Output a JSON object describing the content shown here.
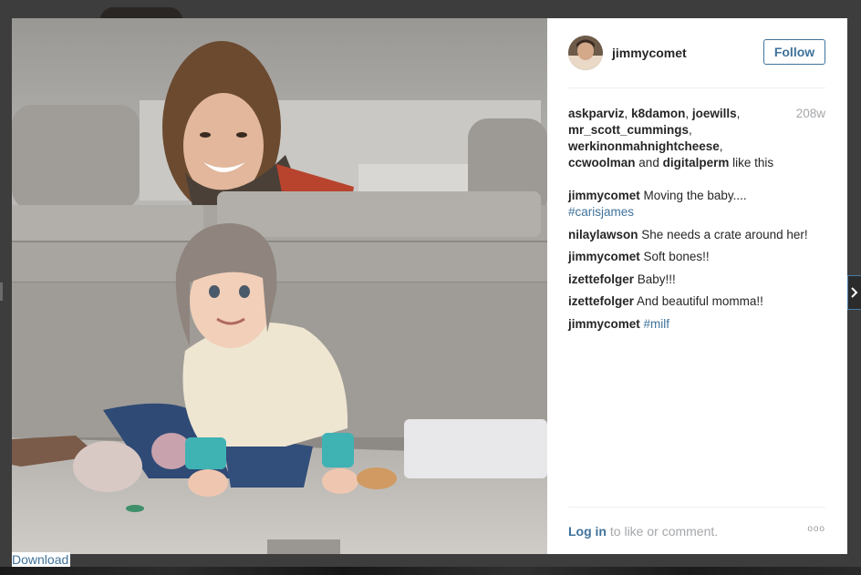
{
  "post": {
    "username": "jimmycomet",
    "follow_label": "Follow",
    "time_ago": "208w",
    "likes_users": [
      "askparviz",
      "k8damon",
      "joewills",
      "mr_scott_cummings",
      "werkinonmahnightcheese",
      "ccwoolman"
    ],
    "likes_and": "and",
    "likes_last_user": "digitalperm",
    "likes_suffix": "like this",
    "comments": [
      {
        "user": "jimmycomet",
        "text": "Moving the baby....",
        "tag": "#carisjames"
      },
      {
        "user": "nilaylawson",
        "text": "She needs a crate around her!",
        "tag": ""
      },
      {
        "user": "jimmycomet",
        "text": "Soft bones!!",
        "tag": ""
      },
      {
        "user": "izettefolger",
        "text": "Baby!!!",
        "tag": ""
      },
      {
        "user": "izettefolger",
        "text": "And beautiful momma!!",
        "tag": ""
      },
      {
        "user": "jimmycomet",
        "text": "",
        "tag": "#milf"
      }
    ],
    "login_label": "Log in",
    "login_suffix": "to like or comment.",
    "more_label": "ooo"
  },
  "download_label": "Download",
  "next_arrow_icon": "chevron-right-icon",
  "colors": {
    "link": "#3f729b",
    "muted": "#a5a7aa"
  }
}
